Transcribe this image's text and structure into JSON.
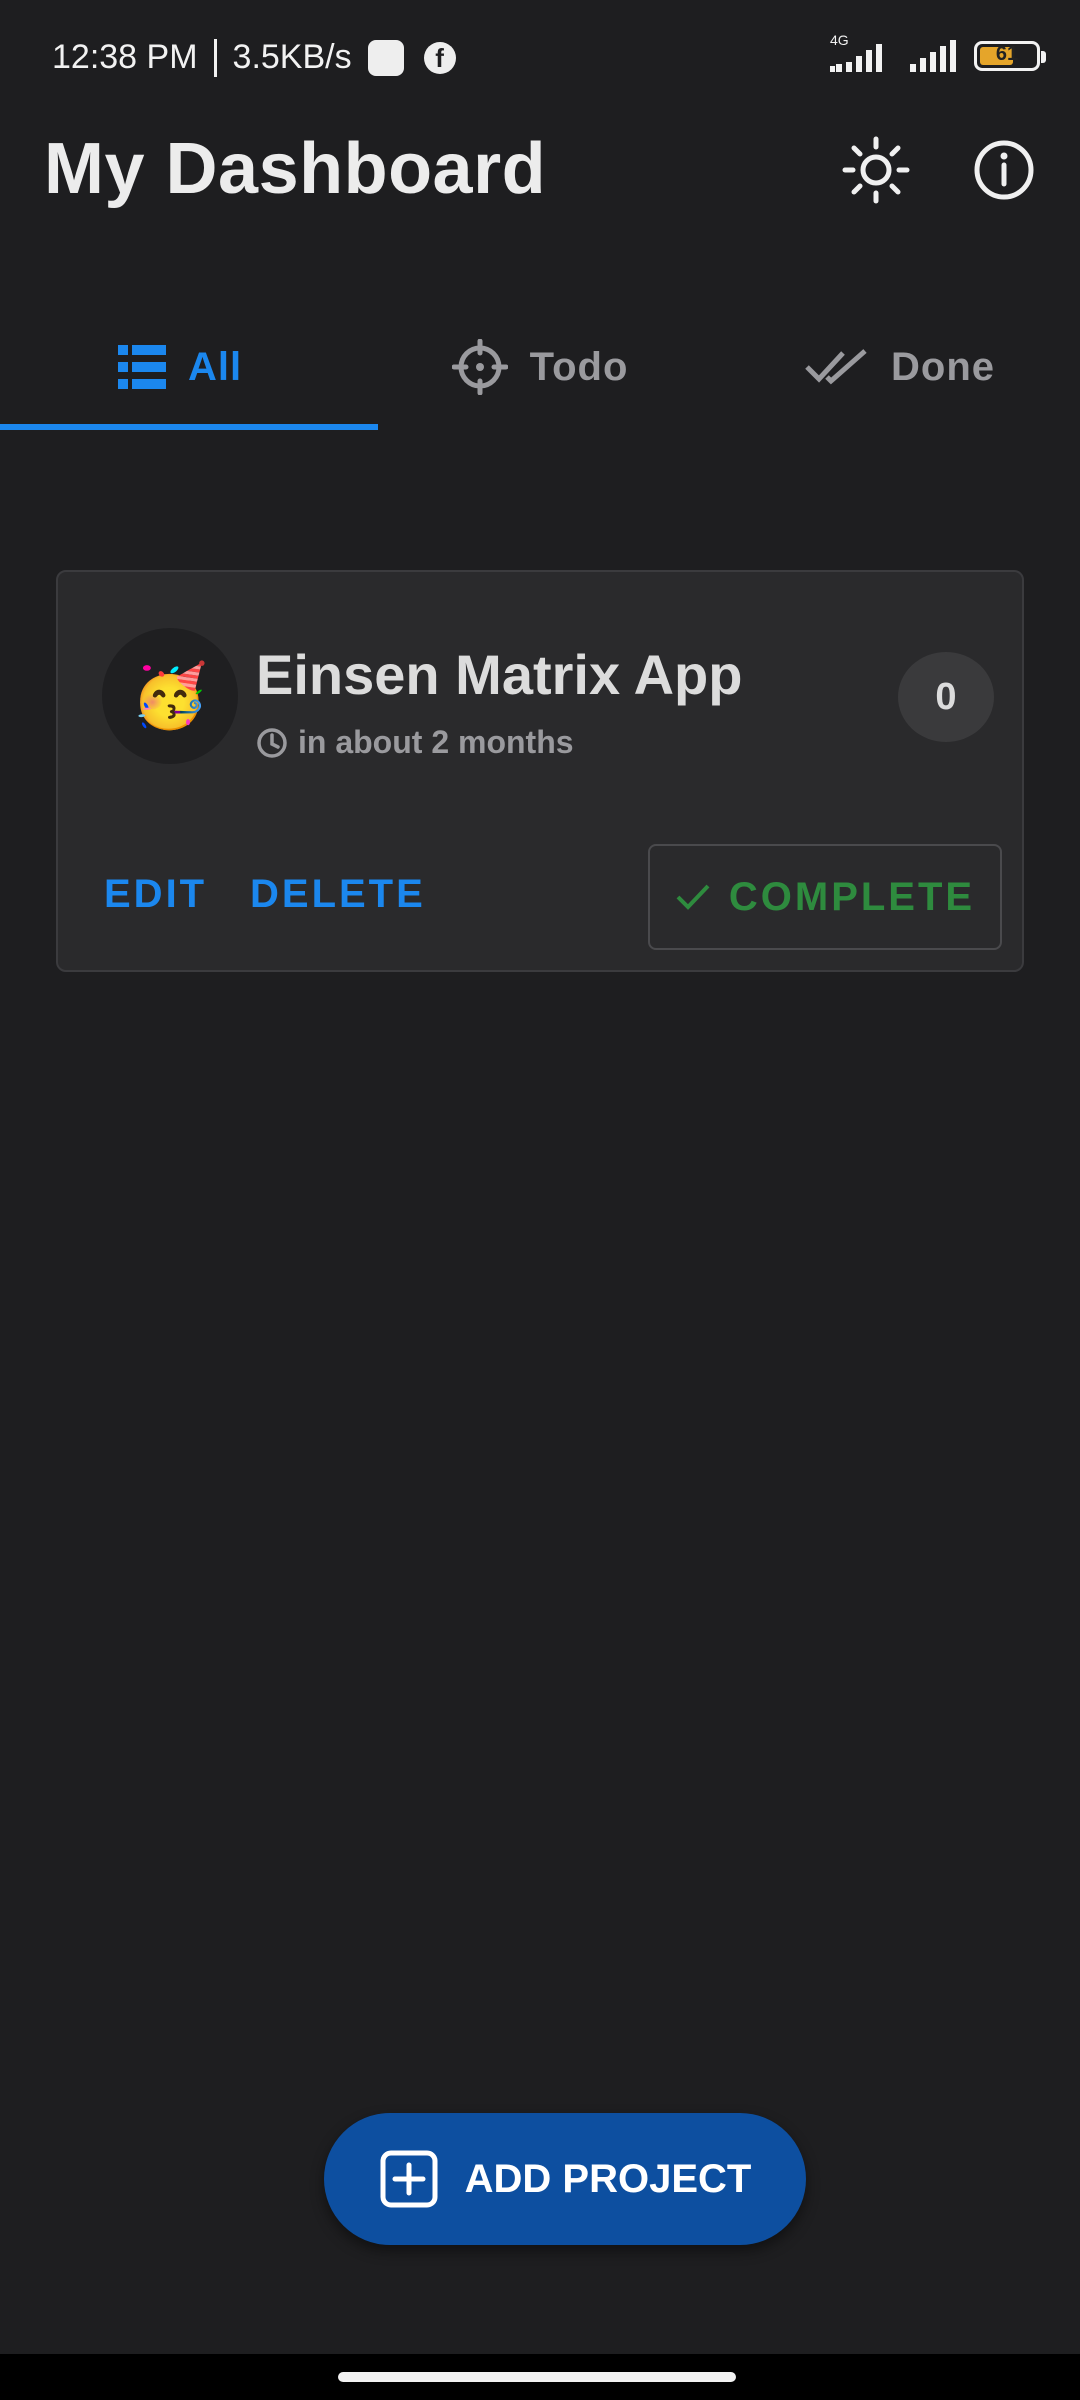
{
  "status_bar": {
    "time": "12:38 PM",
    "speed": "3.5KB/s",
    "network_type": "4G",
    "battery_level": "61",
    "battery_fraction": 0.61
  },
  "header": {
    "title": "My Dashboard",
    "theme_icon": "sun-icon",
    "info_icon": "info-icon"
  },
  "tabs": [
    {
      "label": "All",
      "icon": "list-icon",
      "active": true
    },
    {
      "label": "Todo",
      "icon": "crosshair-icon",
      "active": false
    },
    {
      "label": "Done",
      "icon": "double-check-icon",
      "active": false
    }
  ],
  "project_card": {
    "emoji": "🥳",
    "name": "Einsen Matrix App",
    "due": "in about 2 months",
    "count": "0",
    "edit_label": "EDIT",
    "delete_label": "DELETE",
    "complete_label": "COMPLETE"
  },
  "fab": {
    "label": "ADD PROJECT",
    "icon": "plus-square-icon"
  },
  "colors": {
    "background": "#1e1e20",
    "accent": "#1b87ee",
    "card": "#2a2a2c",
    "complete": "#2e8b3e",
    "fab": "#0d4fa0"
  }
}
